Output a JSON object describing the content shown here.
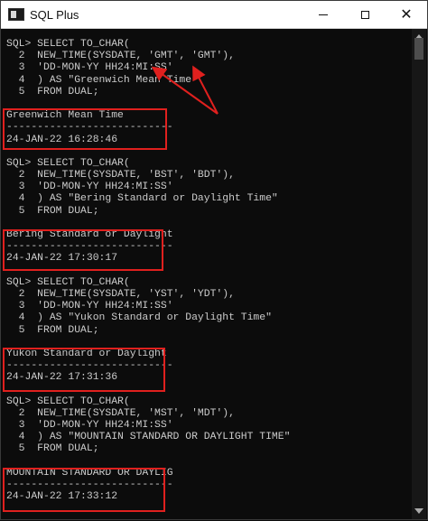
{
  "window": {
    "title": "SQL Plus",
    "controls": {
      "minimize": "—",
      "maximize": "☐",
      "close": "✕"
    }
  },
  "terminal": {
    "lines": [
      "SQL> SELECT TO_CHAR(",
      "  2  NEW_TIME(SYSDATE, 'GMT', 'GMT'),",
      "  3  'DD-MON-YY HH24:MI:SS'",
      "  4  ) AS \"Greenwich Mean Time\"",
      "  5  FROM DUAL;",
      "",
      "Greenwich Mean Time",
      "---------------------------",
      "24-JAN-22 16:28:46",
      "",
      "SQL> SELECT TO_CHAR(",
      "  2  NEW_TIME(SYSDATE, 'BST', 'BDT'),",
      "  3  'DD-MON-YY HH24:MI:SS'",
      "  4  ) AS \"Bering Standard or Daylight Time\"",
      "  5  FROM DUAL;",
      "",
      "Bering Standard or Daylight",
      "---------------------------",
      "24-JAN-22 17:30:17",
      "",
      "SQL> SELECT TO_CHAR(",
      "  2  NEW_TIME(SYSDATE, 'YST', 'YDT'),",
      "  3  'DD-MON-YY HH24:MI:SS'",
      "  4  ) AS \"Yukon Standard or Daylight Time\"",
      "  5  FROM DUAL;",
      "",
      "Yukon Standard or Daylight",
      "---------------------------",
      "24-JAN-22 17:31:36",
      "",
      "SQL> SELECT TO_CHAR(",
      "  2  NEW_TIME(SYSDATE, 'MST', 'MDT'),",
      "  3  'DD-MON-YY HH24:MI:SS'",
      "  4  ) AS \"MOUNTAIN STANDARD OR DAYLIGHT TIME\"",
      "  5  FROM DUAL;",
      "",
      "MOUNTAIN STANDARD OR DAYLIG",
      "---------------------------",
      "24-JAN-22 17:33:12"
    ]
  },
  "colors": {
    "terminal_background": "#0c0c0c",
    "terminal_text": "#cccccc",
    "annotation_red": "#e0201e"
  }
}
